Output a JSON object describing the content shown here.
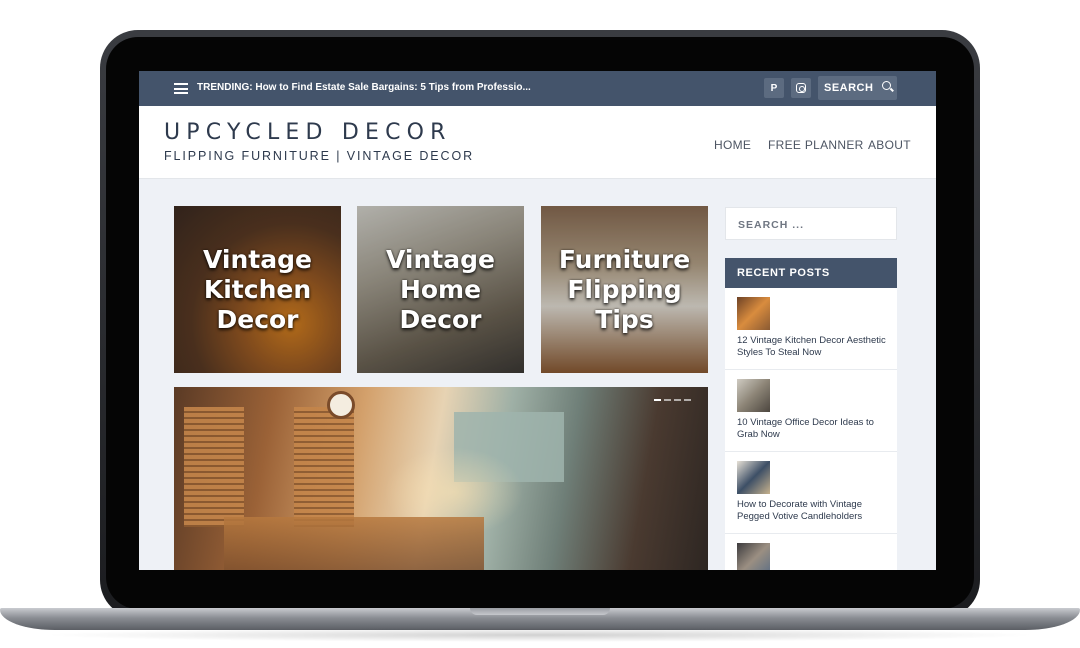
{
  "topbar": {
    "trending_label": "TRENDING:",
    "trending_text": "How to Find Estate Sale Bargains: 5 Tips from Professio...",
    "social": [
      {
        "icon": "pinterest-icon",
        "glyph": "P"
      },
      {
        "icon": "instagram-icon"
      }
    ],
    "search_label": "SEARCH",
    "search_icon": "search-icon"
  },
  "header": {
    "logo_title": "UPCYCLED DECOR",
    "logo_subtitle": "FLIPPING FURNITURE | VINTAGE DECOR",
    "nav": [
      {
        "label": "HOME"
      },
      {
        "label": "FREE PLANNER"
      },
      {
        "label": "ABOUT"
      }
    ]
  },
  "tiles": [
    {
      "title": "Vintage Kitchen Decor"
    },
    {
      "title": "Vintage Home Decor"
    },
    {
      "title": "Furniture Flipping Tips"
    }
  ],
  "sidebar": {
    "search_placeholder": "SEARCH ...",
    "recent_heading": "RECENT POSTS",
    "posts": [
      {
        "title": "12 Vintage Kitchen Decor Aesthetic Styles To Steal Now"
      },
      {
        "title": "10 Vintage Office Decor Ideas to Grab Now"
      },
      {
        "title": "How to Decorate with Vintage Pegged Votive Candleholders"
      },
      {
        "title": ""
      }
    ]
  },
  "colors": {
    "topbar_bg": "#44546b",
    "accent": "#2e3a4d",
    "page_bg": "#eef1f6"
  }
}
